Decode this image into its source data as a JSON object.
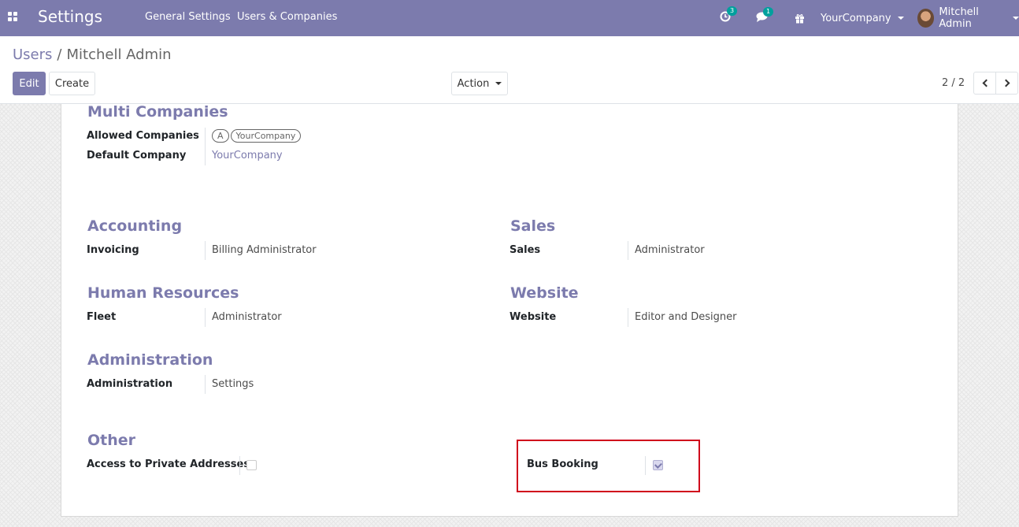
{
  "navbar": {
    "brand": "Settings",
    "menu": [
      "General Settings",
      "Users & Companies"
    ],
    "activity_count": "3",
    "message_count": "1",
    "company": "YourCompany",
    "user": "Mitchell Admin"
  },
  "breadcrumb": {
    "parent": "Users",
    "separator": "/",
    "current": "Mitchell Admin"
  },
  "buttons": {
    "edit": "Edit",
    "create": "Create",
    "action": "Action"
  },
  "pager": {
    "value": "2 / 2"
  },
  "form": {
    "multi_companies": {
      "title": "Multi Companies",
      "allowed_companies_label": "Allowed Companies",
      "allowed_companies_tags": [
        "A",
        "YourCompany"
      ],
      "default_company_label": "Default Company",
      "default_company_value": "YourCompany"
    },
    "accounting": {
      "title": "Accounting",
      "label": "Invoicing",
      "value": "Billing Administrator"
    },
    "sales": {
      "title": "Sales",
      "label": "Sales",
      "value": "Administrator"
    },
    "human_resources": {
      "title": "Human Resources",
      "label": "Fleet",
      "value": "Administrator"
    },
    "website": {
      "title": "Website",
      "label": "Website",
      "value": "Editor and Designer"
    },
    "administration": {
      "title": "Administration",
      "label": "Administration",
      "value": "Settings"
    },
    "other": {
      "title": "Other",
      "private_addresses_label": "Access to Private Addresses",
      "private_addresses_checked": false,
      "bus_booking_label": "Bus Booking",
      "bus_booking_checked": true
    }
  },
  "colors": {
    "navbar": "#7c7bad",
    "accent": "#7c7bad",
    "highlight_border": "#d0021b",
    "badge": "#00a09d"
  }
}
